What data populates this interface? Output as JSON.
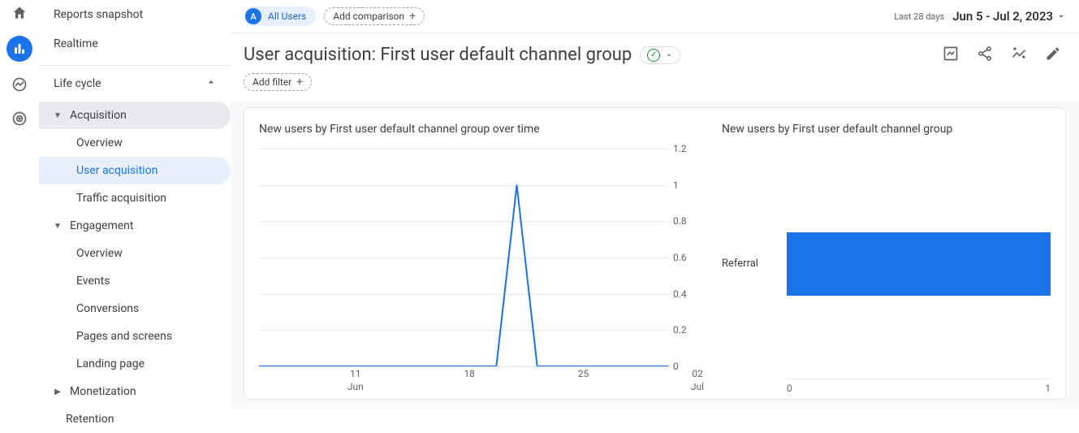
{
  "nav": {
    "top": [
      "Reports snapshot",
      "Realtime"
    ],
    "section": "Life cycle",
    "groups": [
      {
        "label": "Acquisition",
        "expanded": true,
        "highlight": true,
        "items": [
          "Overview",
          "User acquisition",
          "Traffic acquisition"
        ],
        "active": "User acquisition"
      },
      {
        "label": "Engagement",
        "expanded": true,
        "items": [
          "Overview",
          "Events",
          "Conversions",
          "Pages and screens",
          "Landing page"
        ]
      },
      {
        "label": "Monetization",
        "expanded": false,
        "items": []
      }
    ],
    "retention": "Retention"
  },
  "header": {
    "all_users_badge": "A",
    "all_users": "All Users",
    "add_comparison": "Add comparison",
    "date_label": "Last 28 days",
    "date_value": "Jun 5 - Jul 2, 2023"
  },
  "title": "User acquisition: First user default channel group",
  "add_filter": "Add filter",
  "charts": {
    "line_title": "New users by First user default channel group over time",
    "bar_title": "New users by First user default channel group"
  },
  "chart_data": [
    {
      "type": "line",
      "title": "New users by First user default channel group over time",
      "xlabel": "",
      "ylabel": "",
      "ylim": [
        0,
        1.2
      ],
      "y_ticks": [
        0,
        0.2,
        0.4,
        0.6,
        0.8,
        1,
        1.2
      ],
      "x_ticks": [
        {
          "label": "11",
          "sub": "Jun",
          "pos": 0.22
        },
        {
          "label": "18",
          "sub": "",
          "pos": 0.48
        },
        {
          "label": "25",
          "sub": "",
          "pos": 0.74
        },
        {
          "label": "02",
          "sub": "Jul",
          "pos": 1.0
        }
      ],
      "series": [
        {
          "name": "Referral",
          "color": "#1a73e8",
          "points": [
            {
              "x": 0.0,
              "y": 0
            },
            {
              "x": 0.58,
              "y": 0
            },
            {
              "x": 0.63,
              "y": 1
            },
            {
              "x": 0.68,
              "y": 0
            },
            {
              "x": 1.0,
              "y": 0
            }
          ]
        }
      ]
    },
    {
      "type": "bar-horizontal",
      "title": "New users by First user default channel group",
      "xlim": [
        0,
        1
      ],
      "x_ticks": [
        0,
        1
      ],
      "categories": [
        "Referral"
      ],
      "values": [
        1
      ],
      "color": "#1a73e8"
    }
  ]
}
